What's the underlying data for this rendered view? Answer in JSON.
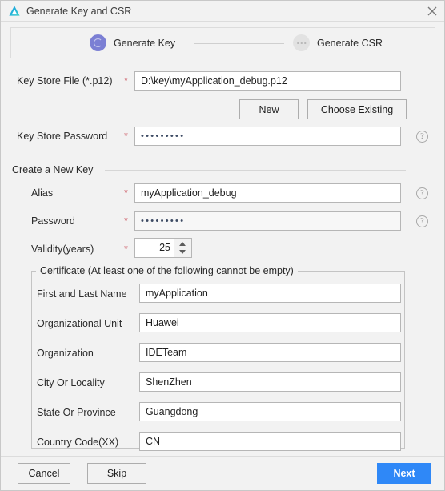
{
  "window": {
    "title": "Generate Key and CSR",
    "app_icon": "deveco-logo-icon",
    "close_icon": "close-icon"
  },
  "stepper": {
    "steps": [
      {
        "label": "Generate Key",
        "state": "active"
      },
      {
        "label": "Generate CSR",
        "state": "inactive"
      }
    ],
    "active_color": "#7b7fd4",
    "inactive_color": "#e2e2e2"
  },
  "form": {
    "required_marker": "*",
    "key_store_file": {
      "label": "Key Store File (*.p12)",
      "value": "D:\\key\\myApplication_debug.p12",
      "placeholder": ""
    },
    "buttons": {
      "new": "New",
      "choose_existing": "Choose Existing"
    },
    "key_store_password": {
      "label": "Key Store Password",
      "value": "•••••••••",
      "help_icon": "question-mark-icon"
    }
  },
  "new_key_section": {
    "title": "Create a New Key",
    "alias": {
      "label": "Alias",
      "value": "myApplication_debug",
      "help_icon": "question-mark-icon"
    },
    "password": {
      "label": "Password",
      "value": "•••••••••",
      "help_icon": "question-mark-icon"
    },
    "validity": {
      "label": "Validity(years)",
      "value": "25"
    }
  },
  "certificate_section": {
    "title": "Certificate (At least one of the following cannot be empty)",
    "fields": [
      {
        "label": "First and Last Name",
        "value": "myApplication"
      },
      {
        "label": "Organizational Unit",
        "value": "Huawei"
      },
      {
        "label": "Organization",
        "value": "IDETeam"
      },
      {
        "label": "City Or Locality",
        "value": "ShenZhen"
      },
      {
        "label": "State Or Province",
        "value": "Guangdong"
      },
      {
        "label": "Country Code(XX)",
        "value": "CN"
      }
    ]
  },
  "footer": {
    "cancel": "Cancel",
    "skip": "Skip",
    "next": "Next",
    "next_color": "#2f88f7"
  }
}
